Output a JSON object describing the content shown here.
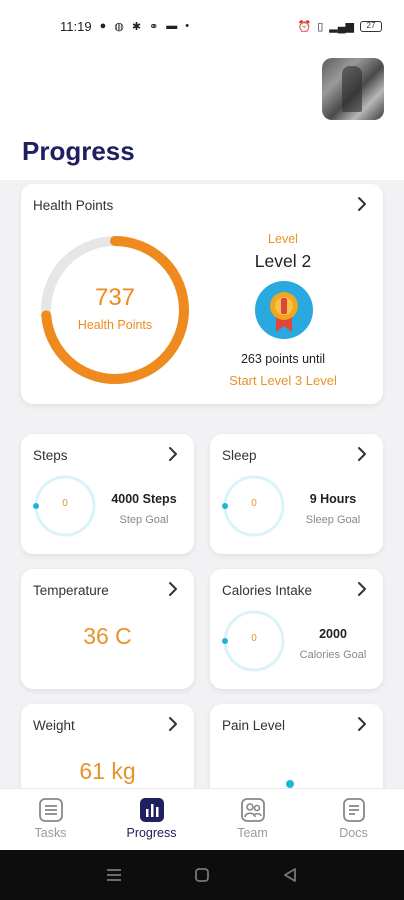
{
  "status_bar": {
    "time": "11:19",
    "battery": "27"
  },
  "page": {
    "title": "Progress"
  },
  "health_points": {
    "title": "Health Points",
    "value": "737",
    "label": "Health Points",
    "level_caption": "Level",
    "level_name": "Level 2",
    "points_until": "263 points until",
    "next_level": "Start Level 3 Level",
    "progress_fraction": 0.737
  },
  "cards": {
    "steps": {
      "title": "Steps",
      "ring_value": "0",
      "goal_value": "4000 Steps",
      "goal_label": "Step Goal"
    },
    "sleep": {
      "title": "Sleep",
      "ring_value": "0",
      "goal_value": "9 Hours",
      "goal_label": "Sleep Goal"
    },
    "temperature": {
      "title": "Temperature",
      "value": "36 C"
    },
    "calories": {
      "title": "Calories Intake",
      "ring_value": "0",
      "goal_value": "2000",
      "goal_label": "Calories Goal"
    },
    "weight": {
      "title": "Weight",
      "value": "61 kg"
    },
    "pain": {
      "title": "Pain Level"
    }
  },
  "tabs": [
    {
      "label": "Tasks",
      "icon": "list-icon"
    },
    {
      "label": "Progress",
      "icon": "bar-chart-icon"
    },
    {
      "label": "Team",
      "icon": "team-icon"
    },
    {
      "label": "Docs",
      "icon": "document-icon"
    }
  ],
  "colors": {
    "title": "#1f2060",
    "accent": "#ef8a1e",
    "ring_track": "#e6e6e6",
    "mini_ring": "#d9f3f8",
    "mini_dot": "#1eb6d6"
  }
}
